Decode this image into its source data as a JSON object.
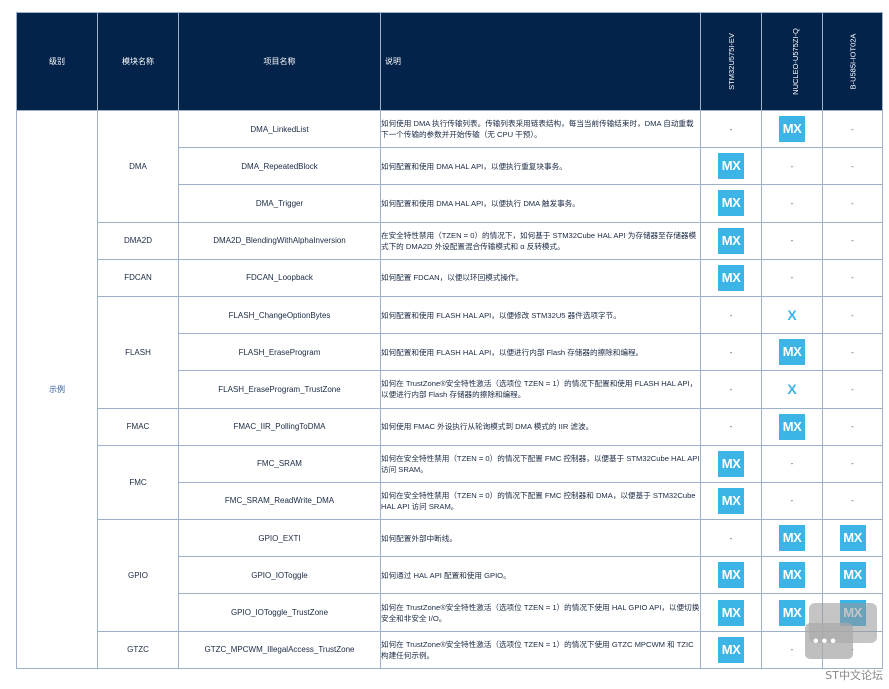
{
  "headers": {
    "level": "级别",
    "module": "模块名称",
    "project": "项目名称",
    "description": "说明",
    "boards": [
      "STM32U575I-EV",
      "NUCLEO-U575ZI-Q",
      "B-U585I-IOT02A"
    ]
  },
  "level_label": "示例",
  "modules": {
    "dma": "DMA",
    "dma2d": "DMA2D",
    "fdcan": "FDCAN",
    "flash": "FLASH",
    "fmac": "FMAC",
    "fmc": "FMC",
    "gpio": "GPIO",
    "gtzc": "GTZC"
  },
  "rows": [
    {
      "project": "DMA_LinkedList",
      "desc": "如何使用 DMA 执行传输列表。传输列表采用链表结构，每当当前传输结束时，DMA 自动重载下一个传输的参数并开始传输（无 CPU 干预）。",
      "b1": "-",
      "b2": "MX",
      "b3": "-"
    },
    {
      "project": "DMA_RepeatedBlock",
      "desc": "如何配置和使用 DMA HAL API，以便执行重复块事务。",
      "b1": "MX",
      "b2": "-",
      "b3": "-"
    },
    {
      "project": "DMA_Trigger",
      "desc": "如何配置和使用 DMA HAL API，以便执行 DMA 触发事务。",
      "b1": "MX",
      "b2": "-",
      "b3": "-"
    },
    {
      "project": "DMA2D_BlendingWithAlphaInversion",
      "desc": "在安全特性禁用（TZEN = 0）的情况下，如何基于 STM32Cube HAL API 为存储器至存储器模式下的 DMA2D 外设配置混合传输模式和 α 反转模式。",
      "b1": "MX",
      "b2": "-",
      "b3": "-"
    },
    {
      "project": "FDCAN_Loopback",
      "desc": "如何配置 FDCAN，以便以环回模式操作。",
      "b1": "MX",
      "b2": "-",
      "b3": "-"
    },
    {
      "project": "FLASH_ChangeOptionBytes",
      "desc": "如何配置和使用 FLASH HAL API，以便修改 STM32U5 器件选项字节。",
      "b1": "-",
      "b2": "X",
      "b3": "-"
    },
    {
      "project": "FLASH_EraseProgram",
      "desc": "如何配置和使用 FLASH HAL API，以便进行内部 Flash 存储器的擦除和编程。",
      "b1": "-",
      "b2": "MX",
      "b3": "-"
    },
    {
      "project": "FLASH_EraseProgram_TrustZone",
      "desc": "如何在 TrustZone®安全特性激活（选项位 TZEN = 1）的情况下配置和使用 FLASH HAL API，以便进行内部 Flash 存储器的擦除和编程。",
      "b1": "-",
      "b2": "X",
      "b3": "-"
    },
    {
      "project": "FMAC_IIR_PollingToDMA",
      "desc": "如何使用 FMAC 外设执行从轮询模式到 DMA 模式的 IIR 滤波。",
      "b1": "-",
      "b2": "MX",
      "b3": "-"
    },
    {
      "project": "FMC_SRAM",
      "desc": "如何在安全特性禁用（TZEN = 0）的情况下配置 FMC 控制器，以便基于 STM32Cube HAL API 访问 SRAM。",
      "b1": "MX",
      "b2": "-",
      "b3": "-"
    },
    {
      "project": "FMC_SRAM_ReadWrite_DMA",
      "desc": "如何在安全特性禁用（TZEN = 0）的情况下配置 FMC 控制器和 DMA，以便基于 STM32Cube HAL API 访问 SRAM。",
      "b1": "MX",
      "b2": "-",
      "b3": "-"
    },
    {
      "project": "GPIO_EXTI",
      "desc": "如何配置外部中断线。",
      "b1": "-",
      "b2": "MX",
      "b3": "MX"
    },
    {
      "project": "GPIO_IOToggle",
      "desc": "如何通过 HAL API 配置和使用 GPIO。",
      "b1": "MX",
      "b2": "MX",
      "b3": "MX"
    },
    {
      "project": "GPIO_IOToggle_TrustZone",
      "desc": "如何在 TrustZone®安全特性激活（选项位 TZEN = 1）的情况下使用 HAL GPIO API，以便切换安全和非安全 I/O。",
      "b1": "MX",
      "b2": "MX",
      "b3": "MX"
    },
    {
      "project": "GTZC_MPCWM_IllegalAccess_TrustZone",
      "desc": "如何在 TrustZone®安全特性激活（选项位 TZEN = 1）的情况下使用 GTZC MPCWM 和 TZIC 构建任何示例。",
      "b1": "MX",
      "b2": "-",
      "b3": "-"
    }
  ],
  "watermark": "ST中文论坛"
}
